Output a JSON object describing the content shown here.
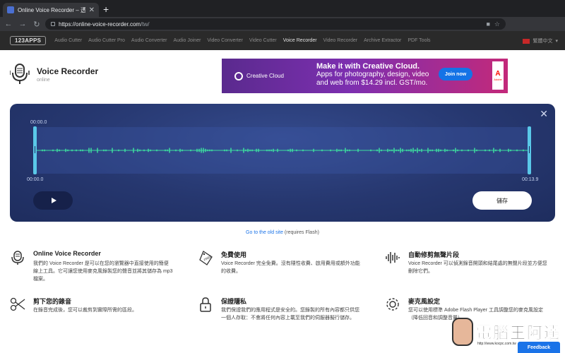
{
  "browser": {
    "tab_title": "Online Voice Recorder – 透過網…",
    "url_host": "https://online-voice-recorder.com",
    "url_path": "/tw/"
  },
  "site_nav": {
    "brand": "123APPS",
    "links": [
      {
        "label": "Audio Cutter",
        "active": false
      },
      {
        "label": "Audio Cutter Pro",
        "active": false
      },
      {
        "label": "Audio Converter",
        "active": false
      },
      {
        "label": "Audio Joiner",
        "active": false
      },
      {
        "label": "Video Converter",
        "active": false
      },
      {
        "label": "Video Cutter",
        "active": false
      },
      {
        "label": "Voice Recorder",
        "active": true
      },
      {
        "label": "Video Recorder",
        "active": false
      },
      {
        "label": "Archive Extractor",
        "active": false
      },
      {
        "label": "PDF Tools",
        "active": false
      }
    ],
    "language": "繁體中文"
  },
  "app": {
    "title": "Voice Recorder",
    "subtitle": "online"
  },
  "ad": {
    "brand": "Creative Cloud",
    "headline": "Make it with Creative Cloud.",
    "body_line1": "Apps for photography, design, video",
    "body_line2": "and web from $14.29 incl. GST/mo.",
    "cta": "Join now",
    "adobe_label": "Adobe"
  },
  "recorder": {
    "marker_time": "00:00.0",
    "start_time": "00:00.0",
    "end_time": "00:13.9",
    "save_label": "儲存"
  },
  "old_site": {
    "link": "Go to the old site",
    "note": " (requires Flash)"
  },
  "features": [
    {
      "title": "Online Voice Recorder",
      "body": "我們的 Voice Recorder 是可以在您的瀏覽器中直接使用的簡便線上工具。它可讓您使用麥克風錄製您的聲音並將其儲存為 mp3 檔案。",
      "icon": "microphone-icon"
    },
    {
      "title": "免費使用",
      "body": "Voice Recorder 完全免費。沒有隱性收費、啟用費用或額外功能的收費。",
      "icon": "free-tag-icon"
    },
    {
      "title": "自動修剪無聲片段",
      "body": "Voice Recorder 可以偵測錄音開頭和結尾處的無聲片段並方便您刪除它們。",
      "icon": "waveform-icon"
    },
    {
      "title": "剪下您的錄音",
      "body": "在錄音完成後，您可以裁剪到實際所需的區段。",
      "icon": "scissors-icon"
    },
    {
      "title": "保證隱私",
      "body": "我們保證我們的應用程式是安全的。您錄製的所有內容都只供您一個人存取：不會將任何內容上載至我們的伺服器擬行儲存。",
      "icon": "padlock-icon"
    },
    {
      "title": "麥克風設定",
      "body": "您可以使用標準 Adobe Flash Player 工具調整您的麥克風設定（降低回音和調整音量）。",
      "icon": "gear-icon"
    }
  ],
  "feedback_label": "Feedback",
  "watermark": {
    "text": "電腦王阿達",
    "url": "http://www.kocpc.com.tw"
  }
}
